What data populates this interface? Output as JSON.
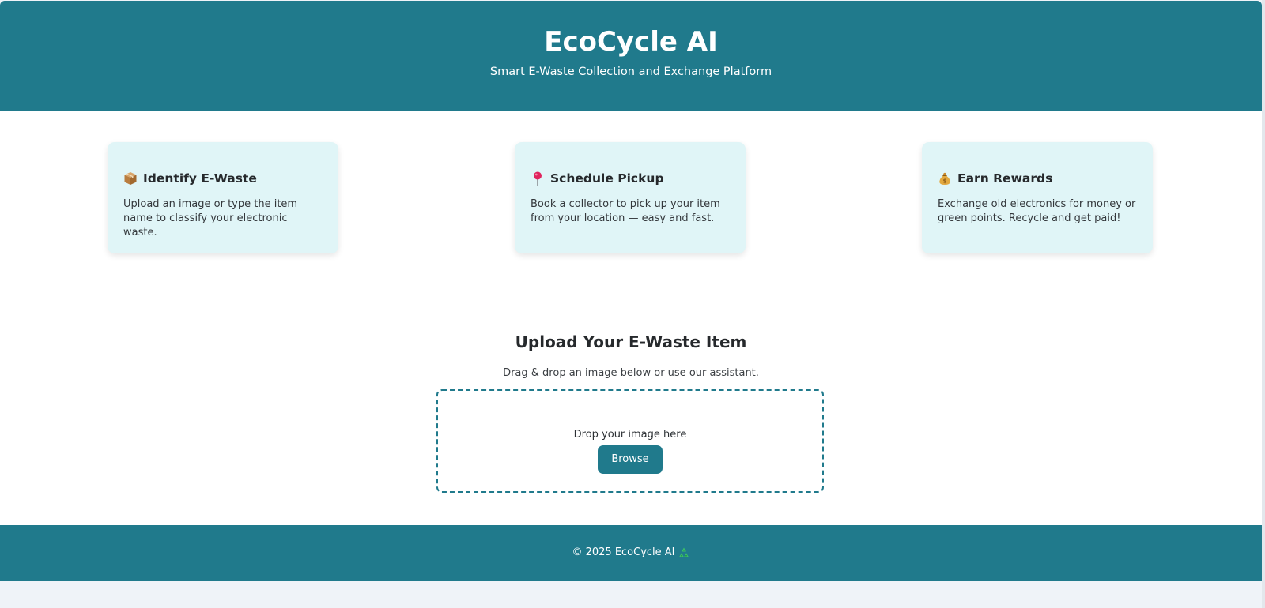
{
  "header": {
    "title": "EcoCycle AI",
    "subtitle": "Smart E-Waste Collection and Exchange Platform"
  },
  "features": [
    {
      "icon": "package-icon",
      "title": "Identify E-Waste",
      "description": "Upload an image or type the item name to classify your electronic waste."
    },
    {
      "icon": "pushpin-icon",
      "title": "Schedule Pickup",
      "description": "Book a collector to pick up your item from your location — easy and fast."
    },
    {
      "icon": "money-bag-icon",
      "title": "Earn Rewards",
      "description": "Exchange old electronics for money or green points. Recycle and get paid!"
    }
  ],
  "upload": {
    "title": "Upload Your E-Waste Item",
    "subtitle": "Drag & drop an image below or use our assistant.",
    "drop_text": "Drop your image here",
    "browse_label": "Browse"
  },
  "footer": {
    "text": "© 2025 EcoCycle AI",
    "icon": "recycle-icon"
  },
  "colors": {
    "primary": "#207a8c",
    "card_background": "#e0f5f7",
    "page_background": "#eff3f8"
  }
}
